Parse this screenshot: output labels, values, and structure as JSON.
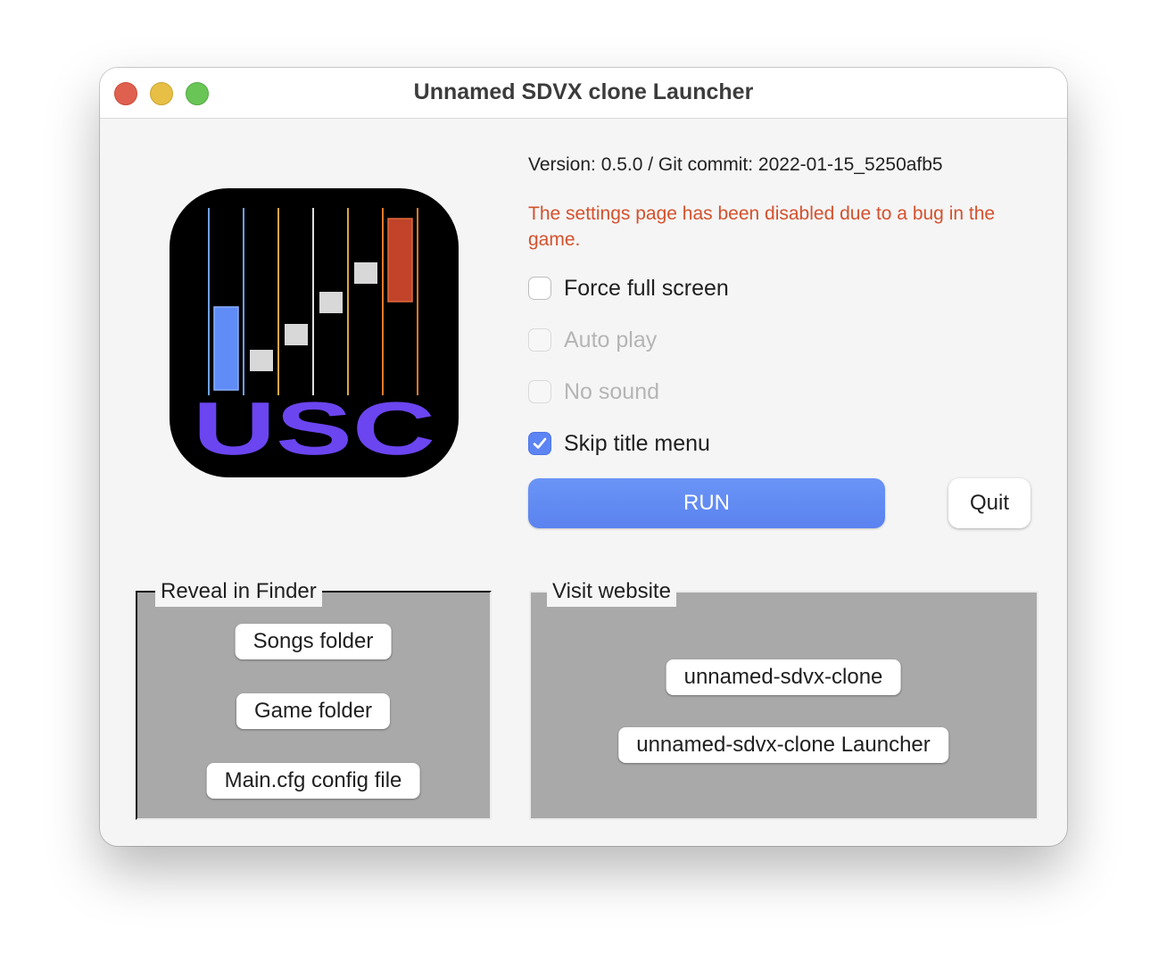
{
  "window": {
    "title": "Unnamed SDVX clone Launcher"
  },
  "logo": {
    "text": "USC"
  },
  "info": {
    "version": "Version: 0.5.0 / Git commit: 2022-01-15_5250afb5",
    "warning": "The settings page has been disabled due to a bug in the game."
  },
  "options": [
    {
      "label": "Force full screen",
      "checked": false,
      "enabled": true
    },
    {
      "label": "Auto play",
      "checked": false,
      "enabled": false
    },
    {
      "label": "No sound",
      "checked": false,
      "enabled": false
    },
    {
      "label": "Skip title menu",
      "checked": true,
      "enabled": true
    }
  ],
  "actions": {
    "run_label": "RUN",
    "quit_label": "Quit"
  },
  "reveal_in_finder": {
    "legend": "Reveal in Finder",
    "buttons": [
      "Songs folder",
      "Game folder",
      "Main.cfg config file"
    ]
  },
  "visit_website": {
    "legend": "Visit website",
    "buttons": [
      "unnamed-sdvx-clone",
      "unnamed-sdvx-clone Launcher"
    ]
  },
  "colors": {
    "accent": "#5c84f3",
    "warning": "#d5512d",
    "logo_text": "#6b45f0",
    "logo_bar_blue": "#5f8cf6",
    "logo_bar_orange": "#c0432a"
  }
}
